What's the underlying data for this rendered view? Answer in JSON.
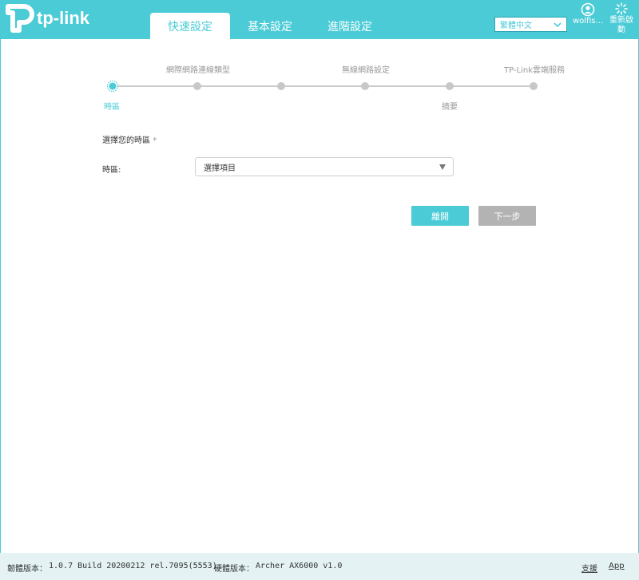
{
  "header": {
    "brand": "tp-link",
    "tabs": [
      {
        "label": "快速設定",
        "active": true
      },
      {
        "label": "基本設定",
        "active": false
      },
      {
        "label": "進階設定",
        "active": false
      }
    ],
    "language": "繁體中文",
    "user_label": "wolfis...",
    "reboot_label": "重新啟動"
  },
  "stepper": {
    "top_labels": [
      "網際網路連線類型",
      "無線網路設定",
      "TP-Link雲端服務"
    ],
    "bottom_labels": [
      "時區",
      "摘要"
    ],
    "active_step": 0,
    "total_steps": 6
  },
  "form": {
    "section_title": "選擇您的時區",
    "required_mark": "*",
    "timezone_label": "時區:",
    "timezone_value": "選擇項目"
  },
  "buttons": {
    "exit": "離開",
    "next": "下一步"
  },
  "footer": {
    "firmware_label": "韌體版本：",
    "firmware_value": "1.0.7 Build 20200212 rel.7095(5553)",
    "hardware_label": "硬體版本：",
    "hardware_value": "Archer AX6000 v1.0",
    "support": "支援",
    "app": "App"
  },
  "colors": {
    "accent": "#4acbd6",
    "disabled": "#b3b3b3",
    "footer_bg": "#e4f2f4"
  }
}
